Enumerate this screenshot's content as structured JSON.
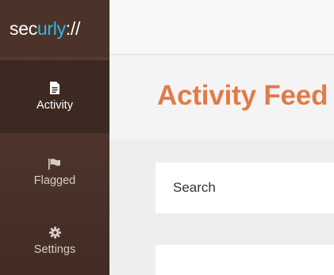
{
  "brand": {
    "prefix": "sec",
    "accent": "urly",
    "suffix": "://",
    "accent_color": "#33b5e5"
  },
  "sidebar": {
    "items": [
      {
        "label": "Activity",
        "icon": "document-icon",
        "active": true
      },
      {
        "label": "Flagged",
        "icon": "flag-icon",
        "active": false
      },
      {
        "label": "Settings",
        "icon": "gear-icon",
        "active": false
      }
    ]
  },
  "main": {
    "title": "Activity Feed",
    "title_color": "#e07b4a",
    "search": {
      "placeholder": "Search"
    }
  }
}
